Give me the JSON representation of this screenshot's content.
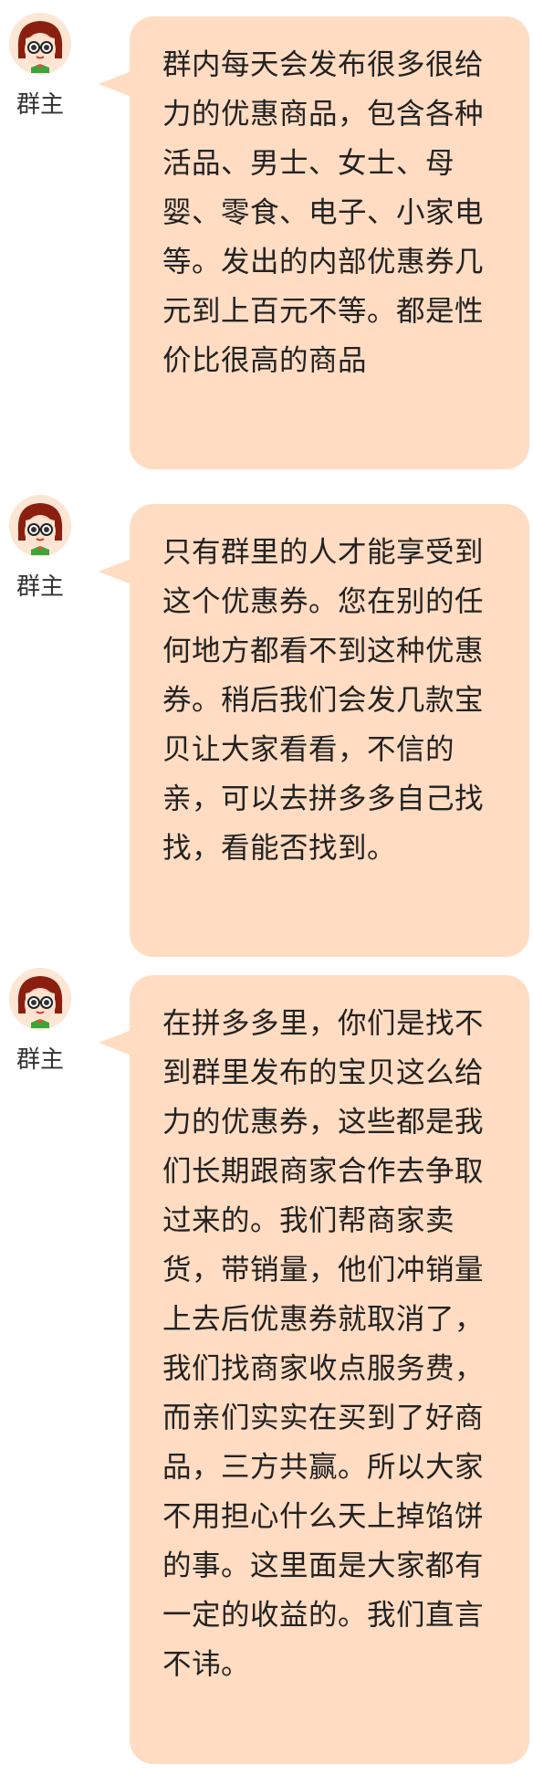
{
  "colors": {
    "bubble": "#ffdcc2",
    "text": "#222222",
    "sender": "#333333",
    "avatar_bg": "#fde6d3"
  },
  "messages": [
    {
      "sender": "群主",
      "avatar": "girl-avatar-icon",
      "text": "群内每天会发布很多很给力的优惠商品，包含各种活品、男士、女士、母婴、零食、电子、小家电等。发出的内部优惠券几元到上百元不等。都是性价比很高的商品"
    },
    {
      "sender": "群主",
      "avatar": "girl-avatar-icon",
      "text": "只有群里的人才能享受到这个优惠券。您在别的任何地方都看不到这种优惠券。稍后我们会发几款宝贝让大家看看，不信的亲，可以去拼多多自己找找，看能否找到。"
    },
    {
      "sender": "群主",
      "avatar": "girl-avatar-icon",
      "text": "在拼多多里，你们是找不到群里发布的宝贝这么给力的优惠券，这些都是我们长期跟商家合作去争取过来的。我们帮商家卖货，带销量，他们冲销量上去后优惠券就取消了，我们找商家收点服务费，而亲们实实在买到了好商品，三方共赢。所以大家不用担心什么天上掉馅饼的事。这里面是大家都有一定的收益的。我们直言不讳。"
    }
  ]
}
